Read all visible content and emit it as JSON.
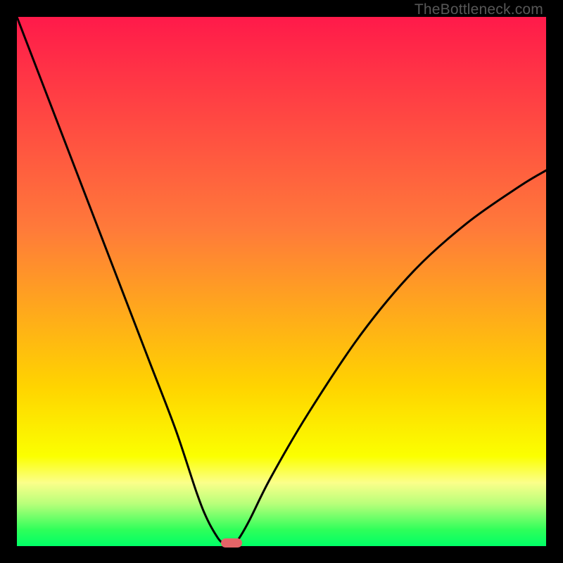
{
  "watermark": "TheBottleneck.com",
  "colors": {
    "frame": "#000000",
    "gradient_top": "#ff1a4a",
    "gradient_mid1": "#ff7a3a",
    "gradient_mid2": "#ffd400",
    "gradient_yellowband": "#fbff8a",
    "gradient_green_top": "#8dff77",
    "gradient_green_bottom": "#00ff66",
    "curve": "#000000",
    "marker": "#e46467"
  },
  "chart_data": {
    "type": "line",
    "title": "",
    "xlabel": "",
    "ylabel": "",
    "xlim": [
      0,
      100
    ],
    "ylim": [
      0,
      100
    ],
    "grid": false,
    "legend": false,
    "series": [
      {
        "name": "bottleneck-curve",
        "x": [
          0,
          5,
          10,
          15,
          20,
          25,
          30,
          34,
          36,
          38,
          39,
          40,
          41,
          42,
          44,
          48,
          55,
          65,
          75,
          85,
          95,
          100
        ],
        "y": [
          100,
          87,
          74,
          61,
          48,
          35,
          22,
          10,
          5,
          1.5,
          0.5,
          0,
          0.5,
          1.5,
          5,
          13,
          25,
          40,
          52,
          61,
          68,
          71
        ]
      }
    ],
    "marker": {
      "x_start": 38.5,
      "x_end": 42.5,
      "y": 0.5
    },
    "background_gradient_stops": [
      {
        "pct": 0,
        "color": "#ff1a4a"
      },
      {
        "pct": 40,
        "color": "#ff7a3a"
      },
      {
        "pct": 70,
        "color": "#ffd400"
      },
      {
        "pct": 83,
        "color": "#fbff00"
      },
      {
        "pct": 88,
        "color": "#fbff8a"
      },
      {
        "pct": 92,
        "color": "#b8ff7a"
      },
      {
        "pct": 97,
        "color": "#2dff5a"
      },
      {
        "pct": 100,
        "color": "#00ff66"
      }
    ]
  }
}
